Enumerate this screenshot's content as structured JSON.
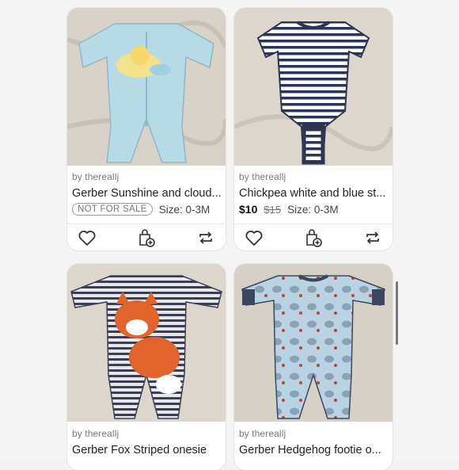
{
  "listings": [
    {
      "seller": "by thereallj",
      "title": "Gerber Sunshine and cloud...",
      "status_badge": "NOT FOR SALE",
      "size": "Size: 0-3M"
    },
    {
      "seller": "by thereallj",
      "title": "Chickpea white and blue st...",
      "price": "$10",
      "original_price": "$15",
      "size": "Size: 0-3M"
    },
    {
      "seller": "by thereallj",
      "title": "Gerber Fox Striped onesie"
    },
    {
      "seller": "by thereallj",
      "title": "Gerber Hedgehog footie o..."
    }
  ],
  "icons": [
    "heart-icon",
    "add-to-bundle-icon",
    "share-icon"
  ],
  "colors": {
    "background": "#f4f4f4",
    "card": "#ffffff",
    "text_primary": "#222222",
    "text_secondary": "#7a7a7a",
    "icon": "#333333"
  }
}
